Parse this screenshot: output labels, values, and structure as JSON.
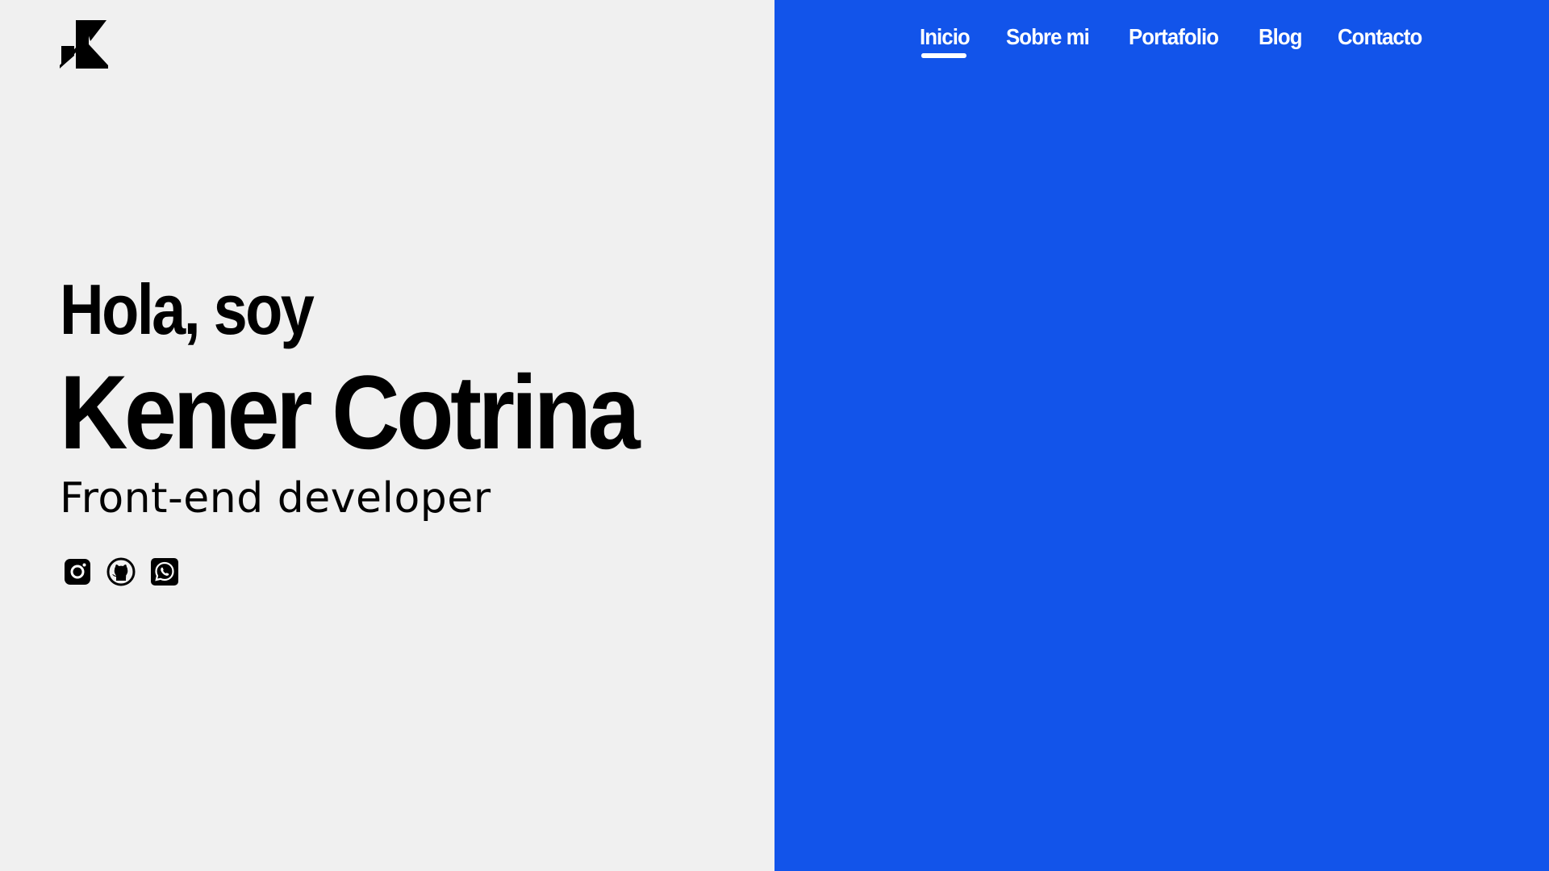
{
  "brand": {
    "logo_icon": "kc-monogram-icon"
  },
  "nav": {
    "items": [
      {
        "label": "Inicio",
        "active": true
      },
      {
        "label": "Sobre mi",
        "active": false
      },
      {
        "label": "Portafolio",
        "active": false
      },
      {
        "label": "Blog",
        "active": false
      },
      {
        "label": "Contacto",
        "active": false
      }
    ]
  },
  "hero": {
    "greeting": "Hola, soy",
    "name": "Kener Cotrina",
    "role": "Front-end developer"
  },
  "socials": [
    {
      "icon": "instagram-icon"
    },
    {
      "icon": "github-icon"
    },
    {
      "icon": "whatsapp-icon"
    }
  ],
  "colors": {
    "left_bg": "#f0f0f0",
    "right_bg": "#1254ea",
    "text_dark": "#000000",
    "text_light": "#ffffff"
  }
}
